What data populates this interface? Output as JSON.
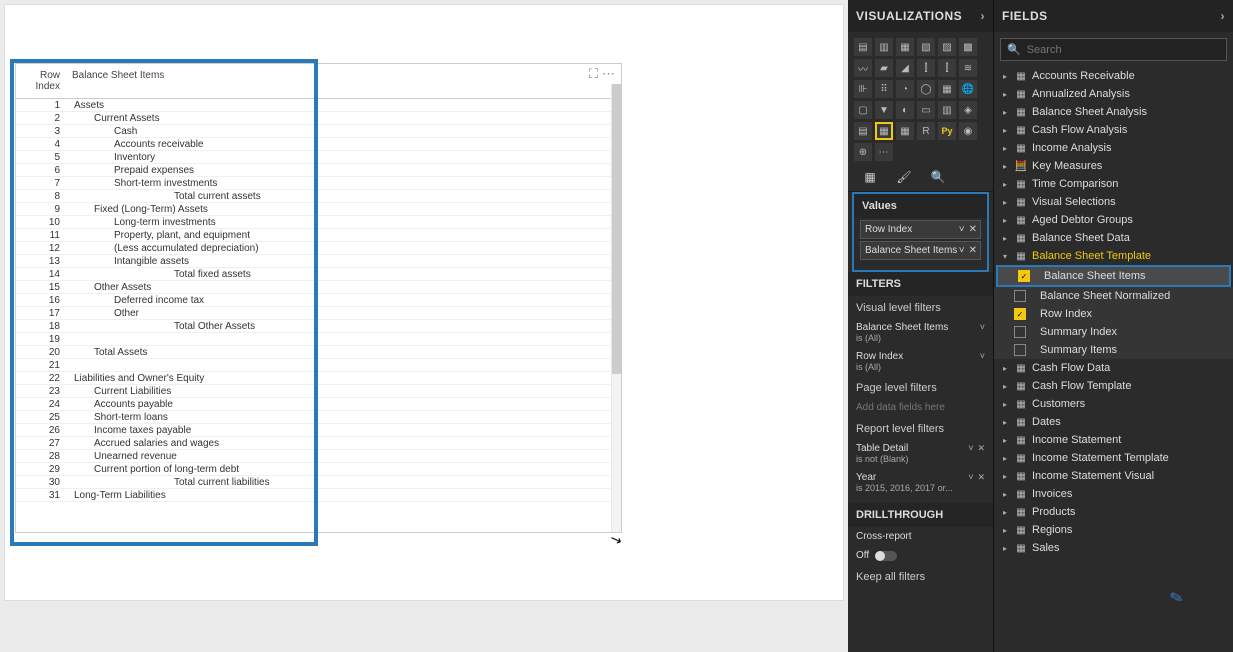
{
  "canvas": {
    "table": {
      "headers": {
        "idx": "Row Index",
        "item": "Balance Sheet Items"
      },
      "rows": [
        {
          "idx": 1,
          "item": "Assets",
          "indent": 0
        },
        {
          "idx": 2,
          "item": "Current Assets",
          "indent": 1
        },
        {
          "idx": 3,
          "item": "Cash",
          "indent": 2
        },
        {
          "idx": 4,
          "item": "Accounts receivable",
          "indent": 2
        },
        {
          "idx": 5,
          "item": "Inventory",
          "indent": 2
        },
        {
          "idx": 6,
          "item": "Prepaid expenses",
          "indent": 2
        },
        {
          "idx": 7,
          "item": "Short-term investments",
          "indent": 2
        },
        {
          "idx": 8,
          "item": "Total current assets",
          "indent": 5
        },
        {
          "idx": 9,
          "item": "Fixed (Long-Term) Assets",
          "indent": 1
        },
        {
          "idx": 10,
          "item": "Long-term investments",
          "indent": 2
        },
        {
          "idx": 11,
          "item": "Property, plant, and equipment",
          "indent": 2
        },
        {
          "idx": 12,
          "item": "(Less accumulated depreciation)",
          "indent": 2
        },
        {
          "idx": 13,
          "item": "Intangible assets",
          "indent": 2
        },
        {
          "idx": 14,
          "item": "Total fixed assets",
          "indent": 5
        },
        {
          "idx": 15,
          "item": "Other Assets",
          "indent": 1
        },
        {
          "idx": 16,
          "item": "Deferred income tax",
          "indent": 2
        },
        {
          "idx": 17,
          "item": "Other",
          "indent": 2
        },
        {
          "idx": 18,
          "item": "Total Other Assets",
          "indent": 5
        },
        {
          "idx": 19,
          "item": "",
          "indent": 0
        },
        {
          "idx": 20,
          "item": "Total Assets",
          "indent": 1
        },
        {
          "idx": 21,
          "item": "",
          "indent": 0
        },
        {
          "idx": 22,
          "item": "Liabilities and Owner's Equity",
          "indent": 0
        },
        {
          "idx": 23,
          "item": "Current Liabilities",
          "indent": 1
        },
        {
          "idx": 24,
          "item": "Accounts payable",
          "indent": 1
        },
        {
          "idx": 25,
          "item": "Short-term loans",
          "indent": 1
        },
        {
          "idx": 26,
          "item": "Income taxes payable",
          "indent": 1
        },
        {
          "idx": 27,
          "item": "Accrued salaries and wages",
          "indent": 1
        },
        {
          "idx": 28,
          "item": "Unearned revenue",
          "indent": 1
        },
        {
          "idx": 29,
          "item": "Current portion of long-term debt",
          "indent": 1
        },
        {
          "idx": 30,
          "item": "Total current liabilities",
          "indent": 5
        },
        {
          "idx": 31,
          "item": "Long-Term Liabilities",
          "indent": 0
        }
      ]
    }
  },
  "viz": {
    "title": "VISUALIZATIONS",
    "values_title": "Values",
    "values": [
      "Row Index",
      "Balance Sheet Items"
    ],
    "filters_title": "FILTERS",
    "visual_filters_title": "Visual level filters",
    "visual_filters": [
      {
        "name": "Balance Sheet Items",
        "sub": "is (All)"
      },
      {
        "name": "Row Index",
        "sub": "is (All)"
      }
    ],
    "page_filters_title": "Page level filters",
    "page_filters_placeholder": "Add data fields here",
    "report_filters_title": "Report level filters",
    "report_filters": [
      {
        "name": "Table Detail",
        "sub": "is not (Blank)"
      },
      {
        "name": "Year",
        "sub": "is 2015, 2016, 2017 or..."
      }
    ],
    "drillthrough_title": "DRILLTHROUGH",
    "cross_report": "Cross-report",
    "off_label": "Off",
    "keep_all": "Keep all filters"
  },
  "fields": {
    "title": "FIELDS",
    "search_placeholder": "Search",
    "tables": [
      {
        "name": "Accounts Receivable",
        "type": "table"
      },
      {
        "name": "Annualized Analysis",
        "type": "table"
      },
      {
        "name": "Balance Sheet Analysis",
        "type": "table"
      },
      {
        "name": "Cash Flow Analysis",
        "type": "table"
      },
      {
        "name": "Income Analysis",
        "type": "table"
      },
      {
        "name": "Key Measures",
        "type": "measure"
      },
      {
        "name": "Time Comparison",
        "type": "table"
      },
      {
        "name": "Visual Selections",
        "type": "table"
      },
      {
        "name": "Aged Debtor Groups",
        "type": "table"
      },
      {
        "name": "Balance Sheet Data",
        "type": "table"
      },
      {
        "name": "Balance Sheet Template",
        "type": "table",
        "expanded": true,
        "highlight": true,
        "children": [
          {
            "name": "Balance Sheet Items",
            "checked": true,
            "sel": true
          },
          {
            "name": "Balance Sheet Normalized",
            "checked": false
          },
          {
            "name": "Row Index",
            "checked": true
          },
          {
            "name": "Summary Index",
            "checked": false
          },
          {
            "name": "Summary Items",
            "checked": false
          }
        ]
      },
      {
        "name": "Cash Flow Data",
        "type": "table"
      },
      {
        "name": "Cash Flow Template",
        "type": "table"
      },
      {
        "name": "Customers",
        "type": "table"
      },
      {
        "name": "Dates",
        "type": "table"
      },
      {
        "name": "Income Statement",
        "type": "table"
      },
      {
        "name": "Income Statement Template",
        "type": "table"
      },
      {
        "name": "Income Statement Visual",
        "type": "table"
      },
      {
        "name": "Invoices",
        "type": "table"
      },
      {
        "name": "Products",
        "type": "table"
      },
      {
        "name": "Regions",
        "type": "table"
      },
      {
        "name": "Sales",
        "type": "table"
      }
    ]
  }
}
